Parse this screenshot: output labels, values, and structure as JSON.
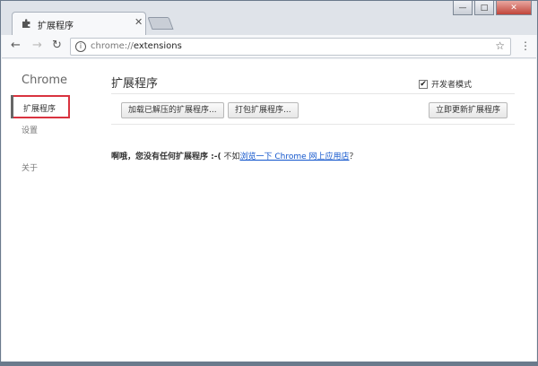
{
  "tab": {
    "title": "扩展程序",
    "close_glyph": "✕"
  },
  "window_controls": {
    "minimize": "—",
    "maximize": "□",
    "close": "✕"
  },
  "toolbar": {
    "back_glyph": "←",
    "forward_glyph": "→",
    "reload_glyph": "↻",
    "info_glyph": "i",
    "url_scheme": "chrome://",
    "url_path": "extensions",
    "bookmark_glyph": "☆",
    "menu_glyph": "⋮"
  },
  "sidebar": {
    "title": "Chrome",
    "items": [
      {
        "label": "扩展程序",
        "active": true
      },
      {
        "label": "设置"
      },
      {
        "label": "关于"
      }
    ]
  },
  "main": {
    "title": "扩展程序",
    "developer_mode": {
      "label": "开发者模式",
      "checked": true,
      "check_glyph": "✔"
    },
    "buttons": {
      "load_unpacked": "加载已解压的扩展程序...",
      "pack": "打包扩展程序...",
      "update_now": "立即更新扩展程序"
    },
    "empty_state": {
      "message": "啊哦，您没有任何扩展程序 :-(",
      "prefix": "不如",
      "link": "浏览一下 Chrome 网上应用店",
      "suffix": "？"
    }
  },
  "colors": {
    "active_outline": "#d9333f",
    "link": "#1155cc"
  }
}
